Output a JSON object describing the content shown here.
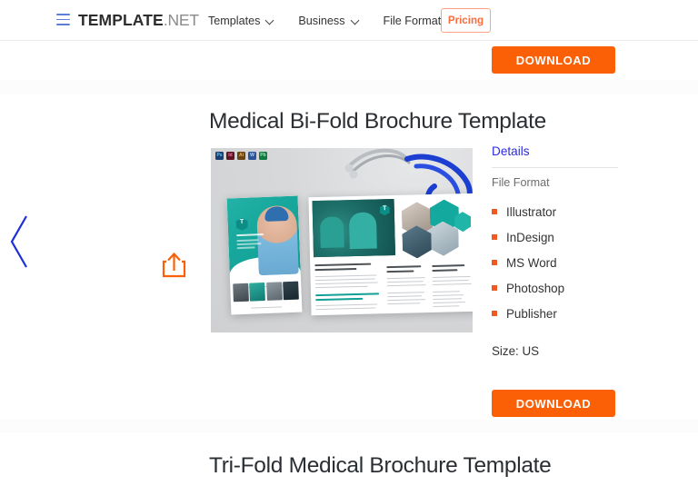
{
  "header": {
    "menu_icon": "hamburger-icon",
    "brand_bold": "TEMPLATE",
    "brand_light": ".NET",
    "nav": [
      {
        "label": "Templates",
        "has_dropdown": true
      },
      {
        "label": "Business",
        "has_dropdown": true
      },
      {
        "label": "File Formats",
        "has_dropdown": true
      }
    ],
    "pricing_label": "Pricing",
    "pricing_color": "#fb6c3d"
  },
  "carousel": {
    "prev_arrow_icon": "chevron-left-icon",
    "prev_arrow_color": "#1b30d8"
  },
  "products": [
    {
      "title": "Medical Bi-Fold Brochure Template",
      "share_icon": "share-upload-icon",
      "share_color": "#fb6007",
      "thumbnail": {
        "alt": "Medical bi-fold brochure mockup with stethoscope",
        "badges": [
          {
            "name": "photoshop-badge",
            "text": "Ps"
          },
          {
            "name": "indesign-badge",
            "text": "Id"
          },
          {
            "name": "illustrator-badge",
            "text": "Ai"
          },
          {
            "name": "word-badge",
            "text": "W"
          },
          {
            "name": "publisher-badge",
            "text": "Pb"
          }
        ],
        "cover_heading": "Dr. Clara Medical Center",
        "cover_sub": "Designing, creating and offering better medical options for you",
        "cover_footer": "Providing healthcare needs since 1990",
        "inner_heading_1": "A Medical Services that keeps you feeling beyond satisfied.",
        "inner_heading_2": "Developing, creating, and offering better medical solutions for you",
        "inner_col_1": "We accomplish excellent HMO Services.",
        "inner_col_2": "Our Medical Services."
      },
      "details_label": "Details",
      "file_format_label": "File Format",
      "formats": [
        "Illustrator",
        "InDesign",
        "MS Word",
        "Photoshop",
        "Publisher"
      ],
      "bullet_color": "#f05a22",
      "size_label": "Size: US",
      "download_label": "DOWNLOAD"
    }
  ],
  "top_download_label": "DOWNLOAD",
  "next_product_title": "Tri-Fold Medical Brochure Template",
  "accent_color": "#fb6007"
}
